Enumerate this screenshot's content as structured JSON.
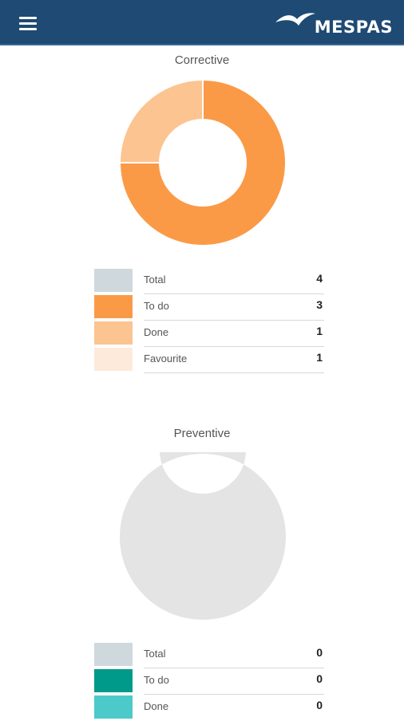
{
  "header": {
    "menu_icon": "hamburger-menu-icon",
    "logo_icon": "bird-logo-icon",
    "brand": "MESPAS",
    "background_color": "#1e4a73"
  },
  "corrective": {
    "title": "Corrective",
    "chart_data": {
      "type": "pie",
      "categories": [
        "To do",
        "Done"
      ],
      "values": [
        3,
        1
      ],
      "colors": [
        "#fb9a46",
        "#fcc490"
      ]
    },
    "legend": [
      {
        "label": "Total",
        "value": "4",
        "color": "#cfd8dc"
      },
      {
        "label": "To do",
        "value": "3",
        "color": "#fb9a46"
      },
      {
        "label": "Done",
        "value": "1",
        "color": "#fcc490"
      },
      {
        "label": "Favourite",
        "value": "1",
        "color": "#fdeadb"
      }
    ]
  },
  "preventive": {
    "title": "Preventive",
    "chart_data": {
      "type": "pie",
      "categories": [
        "To do",
        "Done"
      ],
      "values": [
        0,
        0
      ],
      "colors": [
        "#009a8a",
        "#4cc9c9"
      ],
      "empty_color": "#e4e4e4"
    },
    "legend": [
      {
        "label": "Total",
        "value": "0",
        "color": "#cfd8dc"
      },
      {
        "label": "To do",
        "value": "0",
        "color": "#009a8a"
      },
      {
        "label": "Done",
        "value": "0",
        "color": "#4cc9c9"
      }
    ]
  }
}
